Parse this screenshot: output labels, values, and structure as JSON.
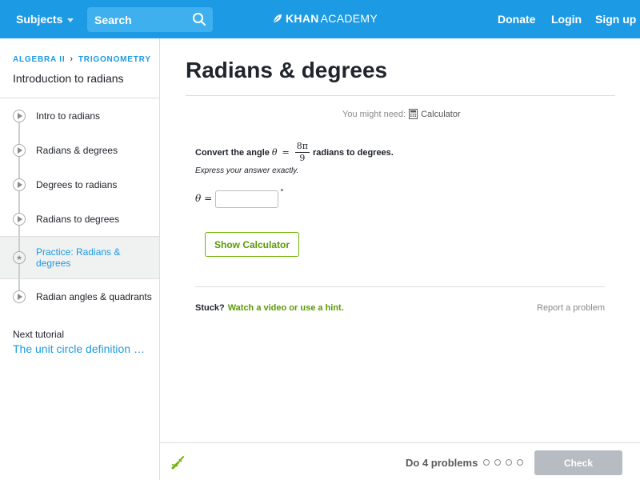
{
  "topbar": {
    "subjects_label": "Subjects",
    "search_placeholder": "Search",
    "logo_bold": "KHAN",
    "logo_regular": "ACADEMY",
    "donate_label": "Donate",
    "login_label": "Login",
    "signup_label": "Sign up",
    "bar_color": "#1c9ae3"
  },
  "sidebar": {
    "breadcrumb": [
      "ALGEBRA II",
      "TRIGONOMETRY"
    ],
    "tutorial_title": "Introduction to radians",
    "items": [
      {
        "label": "Intro to radians",
        "kind": "video",
        "active": false
      },
      {
        "label": "Radians & degrees",
        "kind": "video",
        "active": false
      },
      {
        "label": "Degrees to radians",
        "kind": "video",
        "active": false
      },
      {
        "label": "Radians to degrees",
        "kind": "video",
        "active": false
      },
      {
        "label": "Practice: Radians & degrees",
        "kind": "practice",
        "active": true
      },
      {
        "label": "Radian angles & quadrants",
        "kind": "video",
        "active": false
      }
    ],
    "next_label": "Next tutorial",
    "next_link": "The unit circle definition of sine, cosine, & tangent"
  },
  "main": {
    "title": "Radians & degrees",
    "might_need": "You might need:",
    "calculator_label": "Calculator",
    "question_prefix": "Convert the angle",
    "theta": "θ",
    "equals": "=",
    "fraction_numerator": "8π",
    "fraction_denominator": "9",
    "question_suffix": "radians to degrees.",
    "instruction": "Express your answer exactly.",
    "answer_value": "",
    "degree_symbol": "°",
    "show_calculator_label": "Show Calculator",
    "stuck_label": "Stuck?",
    "stuck_link": "Watch a video or use a hint.",
    "report_label": "Report a problem"
  },
  "footer": {
    "do_problems": "Do 4 problems",
    "dot_count": 4,
    "check_label": "Check"
  },
  "colors": {
    "accent_blue": "#1c9ae3",
    "accent_green": "#71b307",
    "check_disabled": "#b7bcc2"
  }
}
